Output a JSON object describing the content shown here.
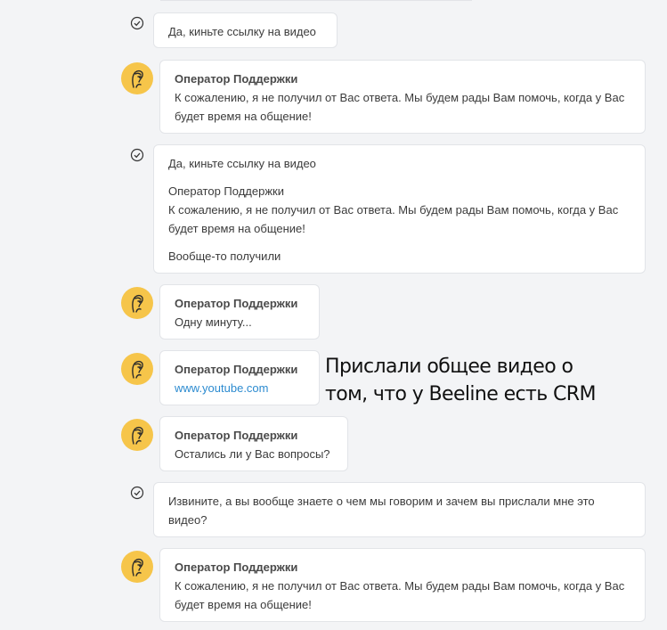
{
  "messages": [
    {
      "type": "user",
      "paragraphs": [
        "Да, киньте ссылку на видео"
      ]
    },
    {
      "type": "operator",
      "sender": "Оператор Поддержки",
      "text": "К сожалению, я не получил от Вас ответа. Мы будем рады Вам помочь, когда у Вас будет время на общение!"
    },
    {
      "type": "user",
      "paragraphs": [
        "Да, киньте ссылку на видео",
        "Оператор Поддержки\nК сожалению, я не получил от Вас ответа. Мы будем рады Вам помочь, когда у Вас будет время на общение!",
        "Вообще-то получили"
      ]
    },
    {
      "type": "operator",
      "sender": "Оператор Поддержки",
      "text": "Одну минуту..."
    },
    {
      "type": "operator",
      "sender": "Оператор Поддержки",
      "link": "www.youtube.com"
    },
    {
      "type": "operator",
      "sender": "Оператор Поддержки",
      "text": "Остались ли у Вас вопросы?"
    },
    {
      "type": "user",
      "paragraphs": [
        "Извините, а вы вообще знаете о чем мы говорим и зачем вы прислали мне это видео?"
      ]
    },
    {
      "type": "operator",
      "sender": "Оператор Поддержки",
      "text": "К сожалению, я не получил от Вас ответа. Мы будем рады Вам помочь, когда у Вас будет время на общение!"
    }
  ],
  "annotation": "Прислали общее видео о том, что у Beeline есть CRM",
  "colors": {
    "background": "#f3f4f6",
    "bubble": "#ffffff",
    "avatar": "#f6c54a",
    "link": "#2c8bd0"
  },
  "icons": {
    "check": "check-circle-icon",
    "avatar": "support-operator-avatar"
  }
}
